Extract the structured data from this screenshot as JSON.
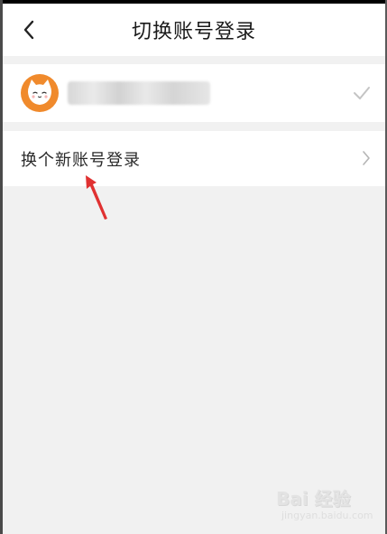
{
  "header": {
    "title": "切换账号登录"
  },
  "account": {
    "name": "████████"
  },
  "new_account": {
    "label": "换个新账号登录"
  },
  "watermark": {
    "main": "Bai 经验",
    "sub": "jingyan.baidu.com"
  },
  "colors": {
    "avatar_orange": "#f08a2c",
    "annotation_arrow": "#e03131",
    "background": "#f1f1f1"
  },
  "icons": {
    "back": "back-arrow-icon",
    "check": "check-icon",
    "chevron": "chevron-right-icon",
    "avatar": "cat-avatar-icon"
  }
}
